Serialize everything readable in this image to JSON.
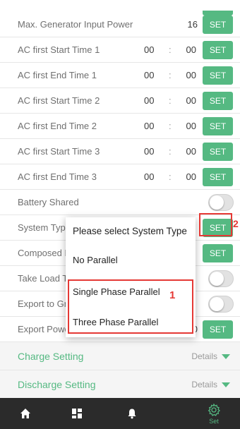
{
  "rows": [
    {
      "label": "Max. Generator Input Power",
      "value": "16",
      "button": "SET"
    },
    {
      "label": "AC first Start Time 1",
      "hours": "00",
      "colon": ":",
      "minutes": "00",
      "button": "SET"
    },
    {
      "label": "AC first End Time 1",
      "hours": "00",
      "colon": ":",
      "minutes": "00",
      "button": "SET"
    },
    {
      "label": "AC first Start Time 2",
      "hours": "00",
      "colon": ":",
      "minutes": "00",
      "button": "SET"
    },
    {
      "label": "AC first End Time 2",
      "hours": "00",
      "colon": ":",
      "minutes": "00",
      "button": "SET"
    },
    {
      "label": "AC first Start Time 3",
      "hours": "00",
      "colon": ":",
      "minutes": "00",
      "button": "SET"
    },
    {
      "label": "AC first End Time 3",
      "hours": "00",
      "colon": ":",
      "minutes": "00",
      "button": "SET"
    },
    {
      "label": "Battery Shared"
    },
    {
      "label": "System Type",
      "button": "SET"
    },
    {
      "label": "Composed P",
      "button": "SET"
    },
    {
      "label": "Take Load To"
    },
    {
      "label": "Export to Gri"
    },
    {
      "label": "Export Powe",
      "value_fragment": "0",
      "button": "SET"
    }
  ],
  "sections": [
    {
      "title": "Charge Setting",
      "details": "Details"
    },
    {
      "title": "Discharge Setting",
      "details": "Details"
    }
  ],
  "popup": {
    "title": "Please select System Type",
    "options": [
      "No Parallel",
      "Single Phase Parallel",
      "Three Phase Parallel"
    ]
  },
  "annotations": {
    "box1": "1",
    "box2": "2"
  },
  "tabbar": {
    "tabs": [
      {
        "icon": "home-icon"
      },
      {
        "icon": "grid-icon"
      },
      {
        "icon": "bell-icon"
      },
      {
        "icon": "gear-icon",
        "label": "Set",
        "active": true
      }
    ]
  },
  "colors": {
    "accent": "#55b982",
    "annotation": "#e53935",
    "tabbar": "#2b2b2b"
  }
}
